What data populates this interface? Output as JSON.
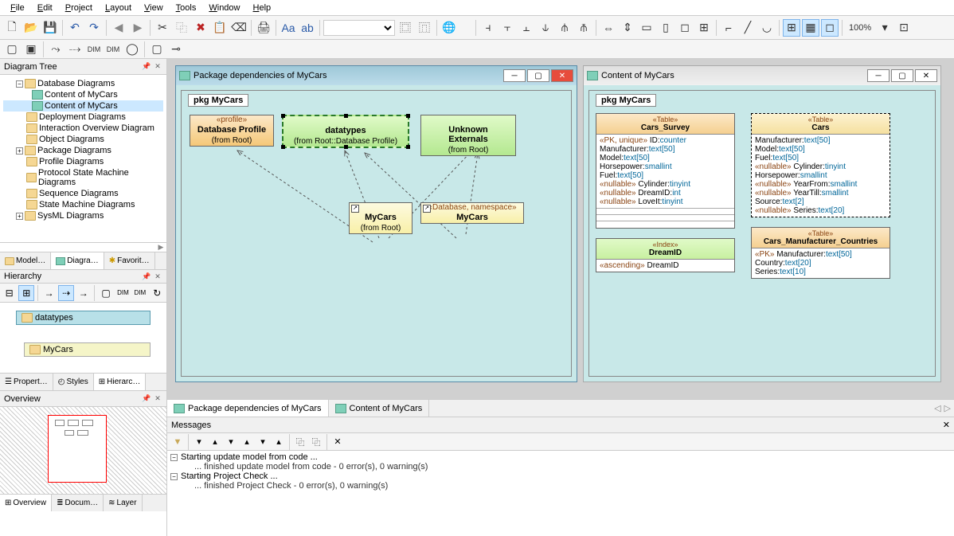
{
  "menu": {
    "file": "File",
    "edit": "Edit",
    "project": "Project",
    "layout": "Layout",
    "view": "View",
    "tools": "Tools",
    "window": "Window",
    "help": "Help"
  },
  "zoom_value": "100%",
  "left": {
    "diagram_tree": {
      "title": "Diagram Tree",
      "items": [
        {
          "label": "Database Diagrams",
          "level": 1,
          "icon": "folder",
          "expand": "−"
        },
        {
          "label": "Content of MyCars",
          "level": 2,
          "icon": "diagram"
        },
        {
          "label": "Content of MyCars",
          "level": 2,
          "icon": "diagram",
          "selected": true
        },
        {
          "label": "Deployment Diagrams",
          "level": 1,
          "icon": "folder"
        },
        {
          "label": "Interaction Overview Diagram",
          "level": 1,
          "icon": "folder"
        },
        {
          "label": "Object Diagrams",
          "level": 1,
          "icon": "folder"
        },
        {
          "label": "Package Diagrams",
          "level": 1,
          "icon": "folder",
          "expand": "+"
        },
        {
          "label": "Profile Diagrams",
          "level": 1,
          "icon": "folder"
        },
        {
          "label": "Protocol State Machine Diagrams",
          "level": 1,
          "icon": "folder"
        },
        {
          "label": "Sequence Diagrams",
          "level": 1,
          "icon": "folder"
        },
        {
          "label": "State Machine Diagrams",
          "level": 1,
          "icon": "folder"
        },
        {
          "label": "SysML Diagrams",
          "level": 1,
          "icon": "folder",
          "expand": "+"
        }
      ],
      "tabs": {
        "model": "Model…",
        "diagram": "Diagra…",
        "favorites": "Favorit…"
      }
    },
    "hierarchy": {
      "title": "Hierarchy",
      "nodes": {
        "datatypes": "datatypes",
        "mycars": "MyCars"
      },
      "tabs": {
        "properties": "Propert…",
        "styles": "Styles",
        "hierarchy": "Hierarc…"
      }
    },
    "overview": {
      "title": "Overview",
      "tabs": {
        "overview": "Overview",
        "documentation": "Docum…",
        "layer": "Layer"
      }
    }
  },
  "doc1": {
    "title": "Package dependencies of MyCars",
    "pkg_label": "pkg MyCars",
    "boxes": {
      "dbprofile": {
        "stereotype": "«profile»",
        "name": "Database Profile",
        "from": "(from Root)"
      },
      "datatypes": {
        "name": "datatypes",
        "from": "(from Root::Database Profile)"
      },
      "externals": {
        "name": "Unknown Externals",
        "from": "(from Root)"
      },
      "mycars": {
        "name": "MyCars",
        "from": "(from Root)"
      },
      "mycars2": {
        "stereotype": "«Database, namespace»",
        "name": "MyCars"
      }
    }
  },
  "doc2": {
    "title": "Content of MyCars",
    "pkg_label": "pkg MyCars",
    "tables": {
      "cars_survey": {
        "stereotype": "«Table»",
        "name": "Cars_Survey",
        "attrs": [
          {
            "st": "«PK, unique»",
            "nm": "ID:",
            "ty": "counter"
          },
          {
            "st": "",
            "nm": "Manufacturer:",
            "ty": "text[50]"
          },
          {
            "st": "",
            "nm": "Model:",
            "ty": "text[50]"
          },
          {
            "st": "",
            "nm": "Horsepower:",
            "ty": "smallint"
          },
          {
            "st": "",
            "nm": "Fuel:",
            "ty": "text[50]"
          },
          {
            "st": "«nullable»",
            "nm": "Cylinder:",
            "ty": "tinyint"
          },
          {
            "st": "«nullable»",
            "nm": "DreamID:",
            "ty": "int"
          },
          {
            "st": "«nullable»",
            "nm": "LoveIt:",
            "ty": "tinyint"
          }
        ]
      },
      "dreamid": {
        "stereotype": "«Index»",
        "name": "DreamID",
        "attrs": [
          {
            "st": "«ascending»",
            "nm": "DreamID",
            "ty": ""
          }
        ]
      },
      "cars": {
        "stereotype": "«Table»",
        "name": "Cars",
        "attrs": [
          {
            "st": "",
            "nm": "Manufacturer:",
            "ty": "text[50]"
          },
          {
            "st": "",
            "nm": "Model:",
            "ty": "text[50]"
          },
          {
            "st": "",
            "nm": "Fuel:",
            "ty": "text[50]"
          },
          {
            "st": "«nullable»",
            "nm": "Cylinder:",
            "ty": "tinyint"
          },
          {
            "st": "",
            "nm": "Horsepower:",
            "ty": "smallint"
          },
          {
            "st": "«nullable»",
            "nm": "YearFrom:",
            "ty": "smallint"
          },
          {
            "st": "«nullable»",
            "nm": "YearTill:",
            "ty": "smallint"
          },
          {
            "st": "",
            "nm": "Source:",
            "ty": "text[2]"
          },
          {
            "st": "«nullable»",
            "nm": "Series:",
            "ty": "text[20]"
          }
        ]
      },
      "cars_mc": {
        "stereotype": "«Table»",
        "name": "Cars_Manufacturer_Countries",
        "attrs": [
          {
            "st": "«PK»",
            "nm": "Manufacturer:",
            "ty": "text[50]"
          },
          {
            "st": "",
            "nm": "Country:",
            "ty": "text[20]"
          },
          {
            "st": "",
            "nm": "Series:",
            "ty": "text[10]"
          }
        ]
      }
    }
  },
  "doc_tabs": {
    "tab1": "Package dependencies of MyCars",
    "tab2": "Content of MyCars"
  },
  "messages": {
    "title": "Messages",
    "lines": {
      "l1": "Starting update model from code ...",
      "l2": "... finished update model from code - 0 error(s), 0 warning(s)",
      "l3": "Starting Project Check ...",
      "l4": "... finished Project Check - 0 error(s), 0 warning(s)"
    }
  }
}
